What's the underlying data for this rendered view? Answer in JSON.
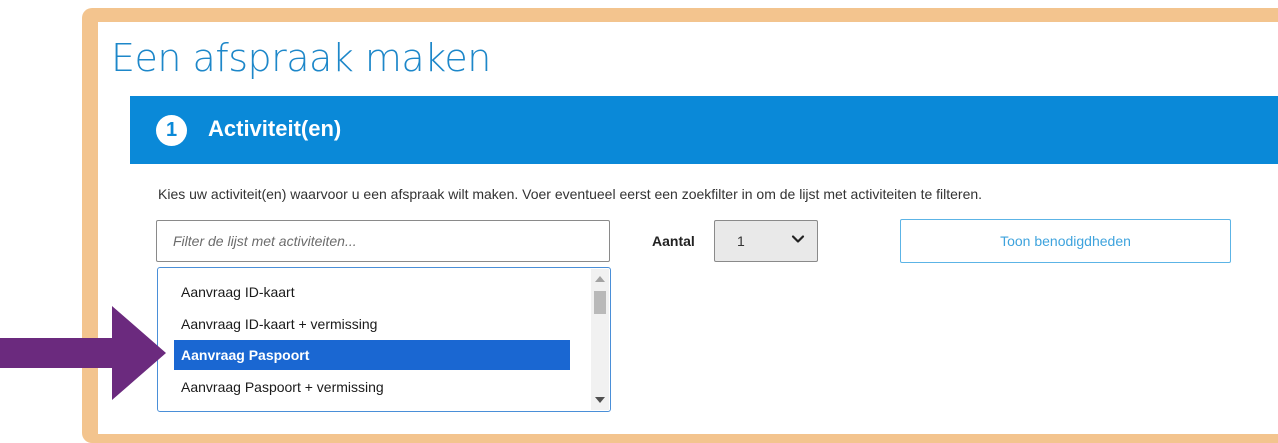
{
  "page": {
    "title": "Een afspraak maken"
  },
  "step": {
    "number": "1",
    "title": "Activiteit(en)",
    "header_color": "#0a89d8"
  },
  "instructions": "Kies uw activiteit(en) waarvoor u een afspraak wilt maken. Voer eventueel eerst een zoekfilter in om de lijst met activiteiten te filteren.",
  "filter": {
    "value": "",
    "placeholder": "Filter de lijst met activiteiten..."
  },
  "count": {
    "label": "Aantal",
    "selected": "1",
    "icon": "chevron-down-icon"
  },
  "needs_button": {
    "label": "Toon benodigdheden"
  },
  "activities": {
    "items": [
      {
        "label": "Aanvraag ID-kaart",
        "selected": false
      },
      {
        "label": "Aanvraag ID-kaart + vermissing",
        "selected": false
      },
      {
        "label": "Aanvraag Paspoort",
        "selected": true
      },
      {
        "label": "Aanvraag Paspoort + vermissing",
        "selected": false
      }
    ]
  },
  "annotation": {
    "arrow_color": "#6b2a7e",
    "frame_color": "#f3c48e",
    "icon": "arrow-right-icon"
  }
}
